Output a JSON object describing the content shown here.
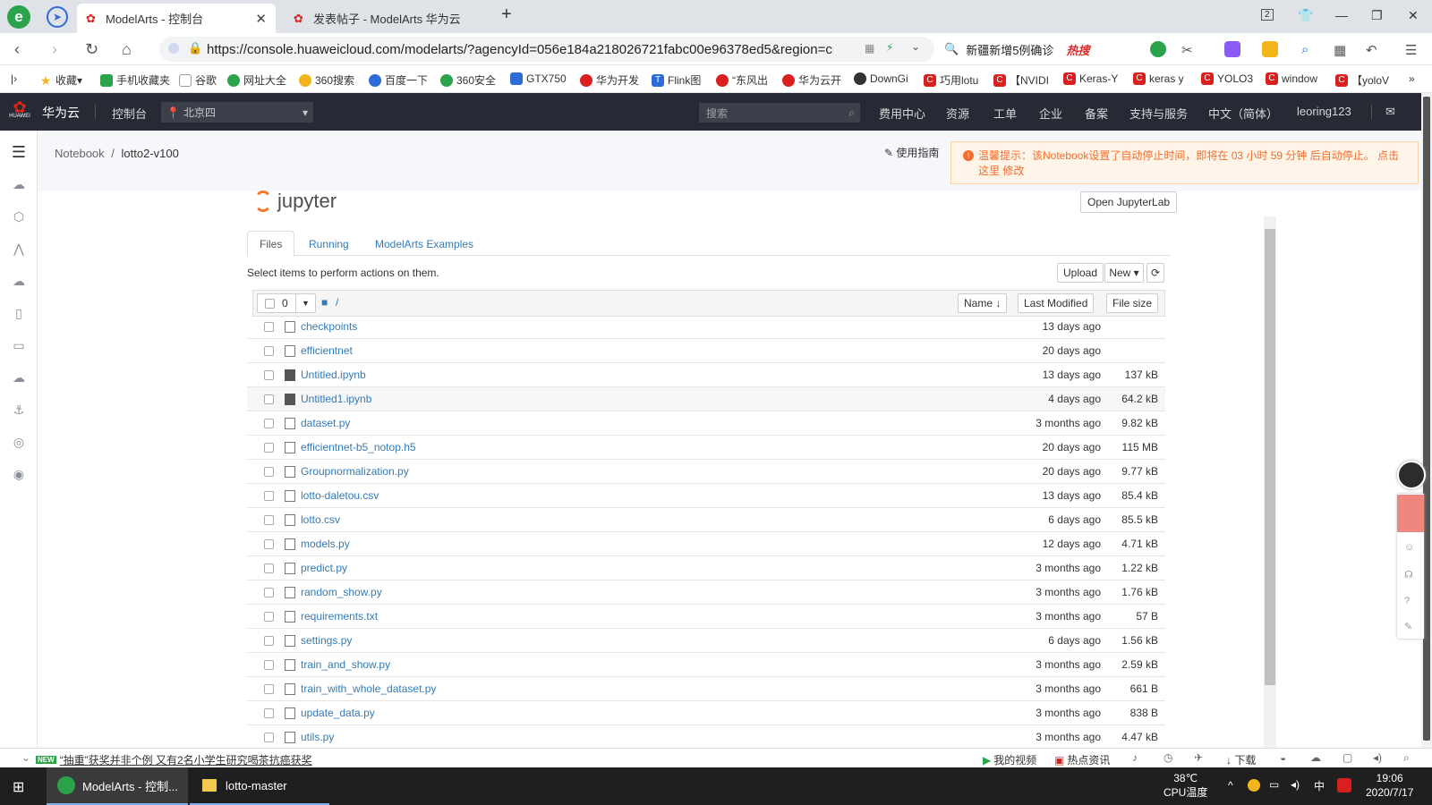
{
  "browser": {
    "tabs": [
      {
        "title": "ModelArts - 控制台",
        "active": true
      },
      {
        "title": "发表帖子 - ModelArts 华为云",
        "active": false
      }
    ],
    "new_tab": "+",
    "win_badge": "2",
    "url": "https://console.huaweicloud.com/modelarts/?agencyId=056e184a218026721fabc00e96378ed5&region=cn-",
    "search_text": "新疆新增5例确诊",
    "search_hot": "热搜",
    "bookmarks": [
      "收藏",
      "手机收藏夹",
      "谷歌",
      "网址大全",
      "360搜索",
      "百度一下",
      "360安全",
      "GTX750",
      "华为开发",
      "Flink图",
      "“东风出",
      "华为云开",
      "DownGi",
      "巧用lotu",
      "【NVIDI",
      "Keras-Y",
      "keras y",
      "YOLO3",
      "window",
      "【yoloV"
    ],
    "bookmarks_more": "»"
  },
  "console": {
    "brand": "华为云",
    "logo_sub": "HUAWEI",
    "nav_console": "控制台",
    "region": "北京四",
    "search_placeholder": "搜索",
    "menu": [
      "费用中心",
      "资源",
      "工单",
      "企业",
      "备案",
      "支持与服务",
      "中文（简体）",
      "leoring123"
    ]
  },
  "breadcrumb": {
    "root": "Notebook",
    "sep": "/",
    "current": "lotto2-v100"
  },
  "guide_label": "使用指南",
  "warning": {
    "text": "温馨提示：该Notebook设置了自动停止时间，即将在 03 小时 59 分钟 后自动停止。 点击",
    "link1": "这里",
    "link2": "修改"
  },
  "jupyter": {
    "logo_text": "jupyter",
    "open_lab": "Open JupyterLab",
    "tabs": [
      "Files",
      "Running",
      "ModelArts Examples"
    ],
    "hint": "Select items to perform actions on them.",
    "upload": "Upload",
    "new": "New",
    "selected_count": "0",
    "path": "/",
    "col_name": "Name",
    "col_modified": "Last Modified",
    "col_size": "File size",
    "files": [
      {
        "name": "checkpoints",
        "type": "folder",
        "modified": "13 days ago",
        "size": ""
      },
      {
        "name": "efficientnet",
        "type": "folder",
        "modified": "20 days ago",
        "size": ""
      },
      {
        "name": "Untitled.ipynb",
        "type": "notebook",
        "modified": "13 days ago",
        "size": "137 kB"
      },
      {
        "name": "Untitled1.ipynb",
        "type": "notebook",
        "modified": "4 days ago",
        "size": "64.2 kB"
      },
      {
        "name": "dataset.py",
        "type": "file",
        "modified": "3 months ago",
        "size": "9.82 kB"
      },
      {
        "name": "efficientnet-b5_notop.h5",
        "type": "file",
        "modified": "20 days ago",
        "size": "115 MB"
      },
      {
        "name": "Groupnormalization.py",
        "type": "file",
        "modified": "20 days ago",
        "size": "9.77 kB"
      },
      {
        "name": "lotto-daletou.csv",
        "type": "file",
        "modified": "13 days ago",
        "size": "85.4 kB"
      },
      {
        "name": "lotto.csv",
        "type": "file",
        "modified": "6 days ago",
        "size": "85.5 kB"
      },
      {
        "name": "models.py",
        "type": "file",
        "modified": "12 days ago",
        "size": "4.71 kB"
      },
      {
        "name": "predict.py",
        "type": "file",
        "modified": "3 months ago",
        "size": "1.22 kB"
      },
      {
        "name": "random_show.py",
        "type": "file",
        "modified": "3 months ago",
        "size": "1.76 kB"
      },
      {
        "name": "requirements.txt",
        "type": "file",
        "modified": "3 months ago",
        "size": "57 B"
      },
      {
        "name": "settings.py",
        "type": "file",
        "modified": "6 days ago",
        "size": "1.56 kB"
      },
      {
        "name": "train_and_show.py",
        "type": "file",
        "modified": "3 months ago",
        "size": "2.59 kB"
      },
      {
        "name": "train_with_whole_dataset.py",
        "type": "file",
        "modified": "3 months ago",
        "size": "661 B"
      },
      {
        "name": "update_data.py",
        "type": "file",
        "modified": "3 months ago",
        "size": "838 B"
      },
      {
        "name": "utils.py",
        "type": "file",
        "modified": "3 months ago",
        "size": "4.47 kB"
      }
    ]
  },
  "statusbar": {
    "news_badge": "NEW",
    "news": "“抽重”获奖并非个例 又有2名小学生研究喝茶抗癌获奖",
    "my_video": "我的视频",
    "hot_news": "热点资讯",
    "download": "下载"
  },
  "taskbar": {
    "items": [
      "ModelArts - 控制...",
      "lotto-master"
    ],
    "temp": "38℃",
    "temp_label": "CPU温度",
    "ime": "中",
    "time": "19:06",
    "date": "2020/7/17"
  }
}
